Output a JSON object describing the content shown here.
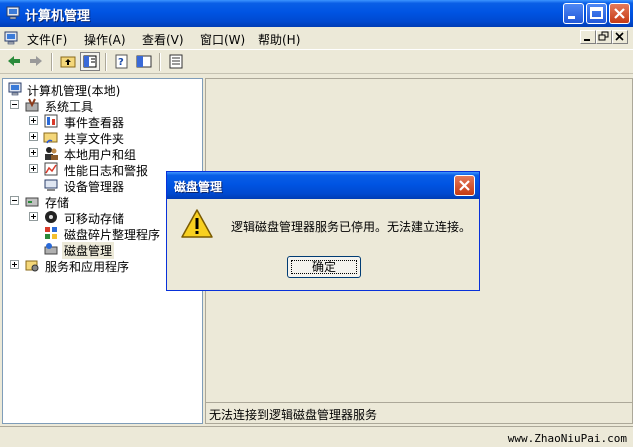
{
  "window": {
    "title": "计算机管理"
  },
  "menu": {
    "items": [
      "文件(F)",
      "操作(A)",
      "查看(V)",
      "窗口(W)",
      "帮助(H)"
    ]
  },
  "tree": {
    "root": "计算机管理(本地)",
    "system_tools": "系统工具",
    "event_viewer": "事件查看器",
    "shared_folders": "共享文件夹",
    "local_users": "本地用户和组",
    "perf_logs": "性能日志和警报",
    "device_manager": "设备管理器",
    "storage": "存储",
    "removable_storage": "可移动存储",
    "defrag": "磁盘碎片整理程序",
    "disk_management": "磁盘管理",
    "services_apps": "服务和应用程序"
  },
  "status": {
    "text": "无法连接到逻辑磁盘管理器服务"
  },
  "dialog": {
    "title": "磁盘管理",
    "message": "逻辑磁盘管理器服务已停用。无法建立连接。",
    "ok_label": "确定"
  },
  "watermark": "www.ZhaoNiuPai.com",
  "colors": {
    "titlebar": "#0054e3",
    "window_bg": "#ece9d8",
    "close": "#c63a14"
  }
}
